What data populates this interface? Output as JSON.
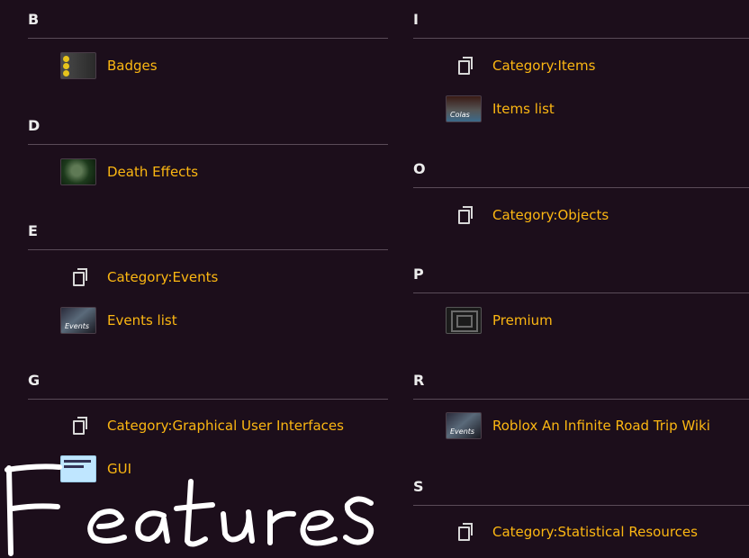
{
  "left_sections": [
    {
      "letter": "B",
      "entries": [
        {
          "label": "Badges",
          "icon": "badges-thumbnail"
        }
      ]
    },
    {
      "letter": "D",
      "entries": [
        {
          "label": "Death Effects",
          "icon": "death-effects-thumbnail"
        }
      ]
    },
    {
      "letter": "E",
      "entries": [
        {
          "label": "Category:Events",
          "icon": "copy-pages-icon"
        },
        {
          "label": "Events list",
          "icon": "events-thumbnail",
          "thumb_text": "Events"
        }
      ]
    },
    {
      "letter": "G",
      "entries": [
        {
          "label": "Category:Graphical User Interfaces",
          "icon": "copy-pages-icon"
        },
        {
          "label": "GUI",
          "icon": "gui-thumbnail"
        }
      ]
    }
  ],
  "right_sections": [
    {
      "letter": "I",
      "entries": [
        {
          "label": "Category:Items",
          "icon": "copy-pages-icon"
        },
        {
          "label": "Items list",
          "icon": "items-thumbnail",
          "thumb_text": "Colas"
        }
      ]
    },
    {
      "letter": "O",
      "entries": [
        {
          "label": "Category:Objects",
          "icon": "copy-pages-icon"
        }
      ]
    },
    {
      "letter": "P",
      "entries": [
        {
          "label": "Premium",
          "icon": "premium-thumbnail"
        }
      ]
    },
    {
      "letter": "R",
      "entries": [
        {
          "label": "Roblox An Infinite Road Trip Wiki",
          "icon": "wiki-thumbnail",
          "thumb_text": "Events"
        }
      ]
    },
    {
      "letter": "S",
      "entries": [
        {
          "label": "Category:Statistical Resources",
          "icon": "copy-pages-icon"
        }
      ]
    }
  ],
  "handwriting": "Features",
  "colors": {
    "background": "#1c0e1b",
    "link": "#fcb712",
    "letter": "#ececec",
    "divider": "#5a4b58",
    "handwriting": "#ffffff"
  }
}
